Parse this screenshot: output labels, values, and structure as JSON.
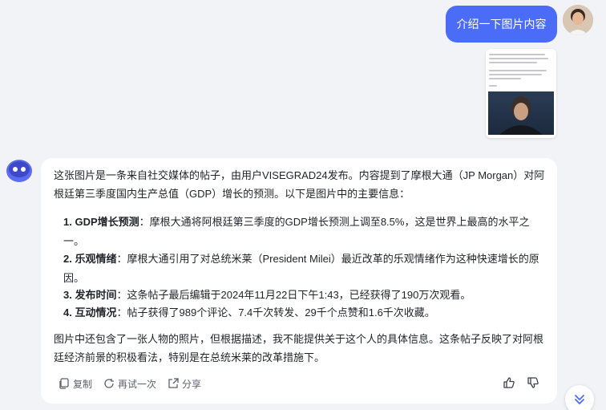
{
  "user": {
    "message": "介绍一下图片内容"
  },
  "answer": {
    "intro": "这张图片是一条来自社交媒体的帖子，由用户VISEGRAD24发布。内容提到了摩根大通（JP Morgan）对阿根廷第三季度国内生产总值（GDP）增长的预测。以下是图片中的主要信息：",
    "items": [
      {
        "num": "1.",
        "key": "GDP增长预测",
        "sep": "：",
        "text": "摩根大通将阿根廷第三季度的GDP增长预测上调至8.5%，这是世界上最高的水平之一。"
      },
      {
        "num": "2.",
        "key": "乐观情绪",
        "sep": "：",
        "text": "摩根大通引用了对总统米莱（President Milei）最近改革的乐观情绪作为这种快速增长的原因。"
      },
      {
        "num": "3.",
        "key": "发布时间",
        "sep": "：",
        "text": "这条帖子最后编辑于2024年11月22日下午1:43，已经获得了190万次观看。"
      },
      {
        "num": "4.",
        "key": "互动情况",
        "sep": "：",
        "text": "帖子获得了989个评论、7.4千次转发、29千个点赞和1.6千次收藏。"
      }
    ],
    "closing": "图片中还包含了一张人物的照片，但根据描述，我不能提供关于这个人的具体信息。这条帖子反映了对阿根廷经济前景的积极看法，特别是在总统米莱的改革措施下。"
  },
  "actions": {
    "copy": "复制",
    "retry": "再试一次",
    "share": "分享"
  },
  "colors": {
    "accent": "#4b6cf6",
    "background": "#f1f3f7",
    "card": "#ffffff"
  },
  "icons": [
    "copy-icon",
    "retry-icon",
    "share-icon",
    "thumbs-up-icon",
    "thumbs-down-icon",
    "chevron-down-icon",
    "bot-avatar-icon"
  ]
}
